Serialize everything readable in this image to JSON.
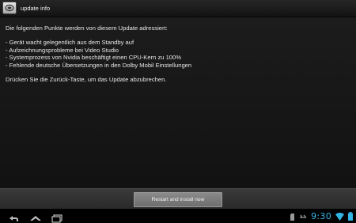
{
  "titlebar": {
    "title": "update info",
    "icon": "app-icon"
  },
  "content": {
    "intro": "Die folgenden Punkte werden von diesem Update adressiert:",
    "items": [
      "- Gerät wacht gelegentlich aus dem Standby auf",
      "- Aufzeichnungsprobleme bei Video Studio",
      "- Systemprozess von Nvidia beschäftigt einen CPU-Kern zu 100%",
      "- Fehlende deutsche Übersetzungen in den Dolby Mobil Einstellungen"
    ],
    "footer": "Drücken Sie die Zurück-Taste, um das Update abzubrechen."
  },
  "buttonbar": {
    "restart_label": "Restart and install now"
  },
  "navbar": {
    "buttons": [
      "back-icon",
      "home-icon",
      "recent-apps-icon"
    ]
  },
  "status": {
    "time": "9:30",
    "icons": [
      "sd-card-icon",
      "usb-icon",
      "wifi-icon",
      "battery-icon"
    ],
    "accent": "#33b5e5"
  }
}
